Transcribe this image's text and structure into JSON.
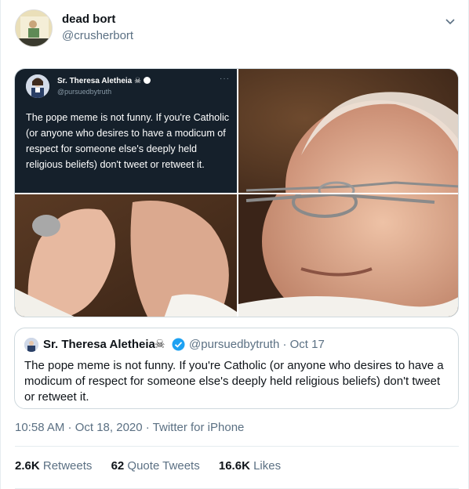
{
  "tweet": {
    "display_name": "dead bort",
    "handle": "@crusherbort",
    "timestamp": "10:58 AM · Oct 18, 2020",
    "source": "Twitter for iPhone",
    "separator": " · "
  },
  "screenshot_tweet": {
    "display_name": "Sr. Theresa Aletheia",
    "name_emoji": "☠",
    "handle": "@pursuedbytruth",
    "text": "The pope meme is not funny. If you're Catholic (or anyone who desires to have a modicum of respect for someone else's deeply held religious beliefs) don't tweet or retweet it.",
    "more": "···"
  },
  "quoted_tweet": {
    "display_name": "Sr. Theresa Aletheia",
    "name_emoji": "☠",
    "handle_date": "@pursuedbytruth · Oct 17",
    "text": "The pope meme is not funny. If you're Catholic (or anyone who desires to have a modicum of respect for someone else's deeply held religious beliefs) don't tweet or retweet it."
  },
  "stats": {
    "retweets_count": "2.6K",
    "retweets_label": "Retweets",
    "quotes_count": "62",
    "quotes_label": "Quote Tweets",
    "likes_count": "16.6K",
    "likes_label": "Likes"
  },
  "colors": {
    "verified_blue": "#1da1f2",
    "muted_text": "#5b7083",
    "dark_tweet_bg": "#15202b"
  },
  "icons": {
    "more": "chevron-down-icon",
    "verified": "verified-badge-icon"
  }
}
